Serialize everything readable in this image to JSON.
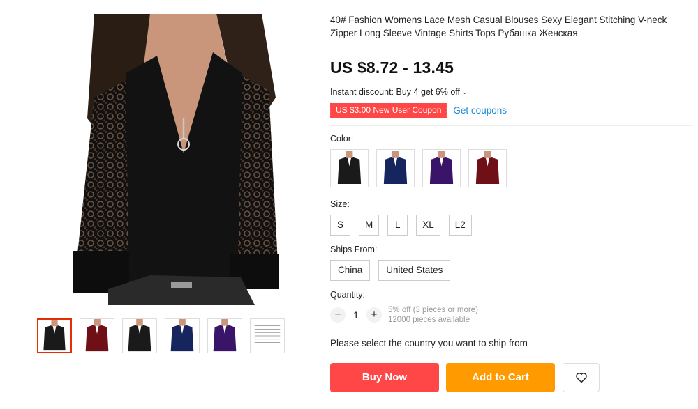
{
  "product": {
    "title": "40# Fashion Womens Lace Mesh Casual Blouses Sexy Elegant Stitching V-neck Zipper Long Sleeve Vintage Shirts Tops Рубашка Женская",
    "price": "US $8.72 - 13.45",
    "instant_discount": "Instant discount: Buy 4 get 6% off",
    "coupon_badge": "US $3.00 New User Coupon",
    "get_coupons": "Get coupons"
  },
  "gallery": {
    "thumbnails": [
      {
        "color": "#1a1a1a",
        "active": true
      },
      {
        "color": "#6e1016"
      },
      {
        "color": "#1a1a1a"
      },
      {
        "color": "#17255e"
      },
      {
        "color": "#3a1468"
      },
      {
        "color": "#ffffff",
        "kind": "size-chart"
      }
    ]
  },
  "options": {
    "color_label": "Color:",
    "colors": [
      "#1a1a1a",
      "#17255e",
      "#3a1468",
      "#6e1016"
    ],
    "size_label": "Size:",
    "sizes": [
      "S",
      "M",
      "L",
      "XL",
      "L2"
    ],
    "ships_from_label": "Ships From:",
    "ships_from": [
      "China",
      "United States"
    ]
  },
  "quantity": {
    "label": "Quantity:",
    "minus": "−",
    "plus": "+",
    "value": "1",
    "discount_note": "5% off (3 pieces or more)",
    "available": "12000 pieces available"
  },
  "shipping_note": "Please select the country you want to ship from",
  "actions": {
    "buy_now": "Buy Now",
    "add_to_cart": "Add to Cart"
  },
  "theme": {
    "accent_red": "#ff4747",
    "accent_orange": "#ff9a00",
    "link_blue": "#1a8ad8"
  }
}
